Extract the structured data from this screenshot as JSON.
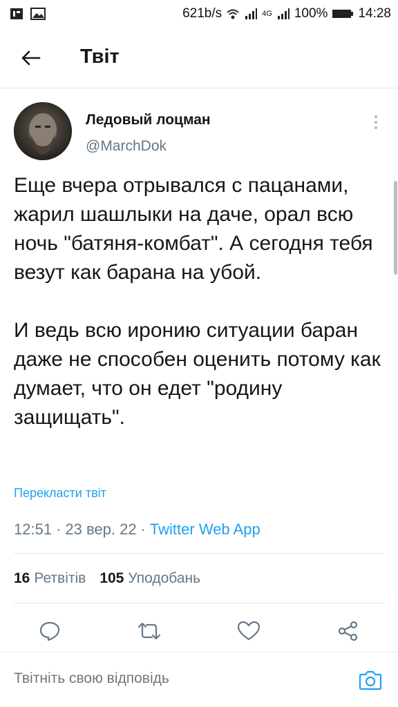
{
  "status_bar": {
    "speed": "621b/s",
    "network": "4G",
    "battery": "100%",
    "time": "14:28"
  },
  "header": {
    "title": "Твіт"
  },
  "tweet": {
    "author_name": "Ледовый лоцман",
    "author_handle": "@MarchDok",
    "text": "Еще вчера отрывался с пацанами, жарил шашлыки на даче, орал всю ночь \"батяня-комбат\". А сегодня тебя везут как барана на убой.\n\nИ ведь всю иронию ситуации баран даже не способен оценить потому как думает, что он едет \"родину защищать\".",
    "translate_label": "Перекласти твіт",
    "time": "12:51",
    "date": "23 вер. 22",
    "separator": "·",
    "source": "Twitter Web App"
  },
  "stats": {
    "retweets_count": "16",
    "retweets_label": "Ретвітів",
    "likes_count": "105",
    "likes_label": "Уподобань"
  },
  "reply": {
    "placeholder": "Твітніть свою відповідь"
  },
  "colors": {
    "accent": "#1da1f2",
    "secondary_text": "#657786",
    "divider": "#e1e8ed"
  },
  "icons": [
    "sim-icon",
    "image-icon",
    "wifi-icon",
    "signal-icon",
    "battery-icon",
    "back-arrow-icon",
    "more-vertical-icon",
    "reply-icon",
    "retweet-icon",
    "like-icon",
    "share-icon",
    "camera-icon"
  ]
}
